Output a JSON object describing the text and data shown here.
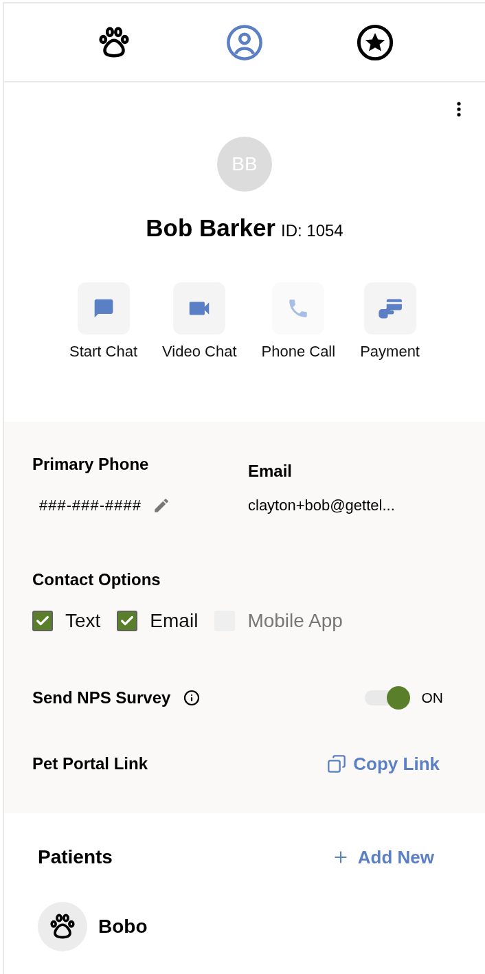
{
  "tabs": [
    {
      "kind": "paw",
      "selected": false
    },
    {
      "kind": "person",
      "selected": true
    },
    {
      "kind": "star",
      "selected": false
    }
  ],
  "client": {
    "initials": "BB",
    "name": "Bob Barker",
    "id_label": "ID: 1054"
  },
  "actions": [
    {
      "kind": "chat",
      "label": "Start Chat",
      "disabled": false
    },
    {
      "kind": "video",
      "label": "Video Chat",
      "disabled": false
    },
    {
      "kind": "phone",
      "label": "Phone Call",
      "disabled": true
    },
    {
      "kind": "payment",
      "label": "Payment",
      "disabled": false
    }
  ],
  "contact": {
    "phone_label": "Primary Phone",
    "phone": "###-###-####",
    "email_label": "Email",
    "email": "clayton+bob@gettel...",
    "options_label": "Contact Options",
    "options": [
      {
        "label": "Text",
        "checked": true,
        "disabled": false
      },
      {
        "label": "Email",
        "checked": true,
        "disabled": false
      },
      {
        "label": "Mobile App",
        "checked": false,
        "disabled": true
      }
    ]
  },
  "nps": {
    "label": "Send NPS Survey",
    "on": true,
    "state_text": "ON"
  },
  "portal": {
    "label": "Pet Portal Link",
    "action": "Copy Link"
  },
  "patients": {
    "title": "Patients",
    "add_label": "Add New",
    "items": [
      {
        "name": "Bobo"
      }
    ]
  }
}
